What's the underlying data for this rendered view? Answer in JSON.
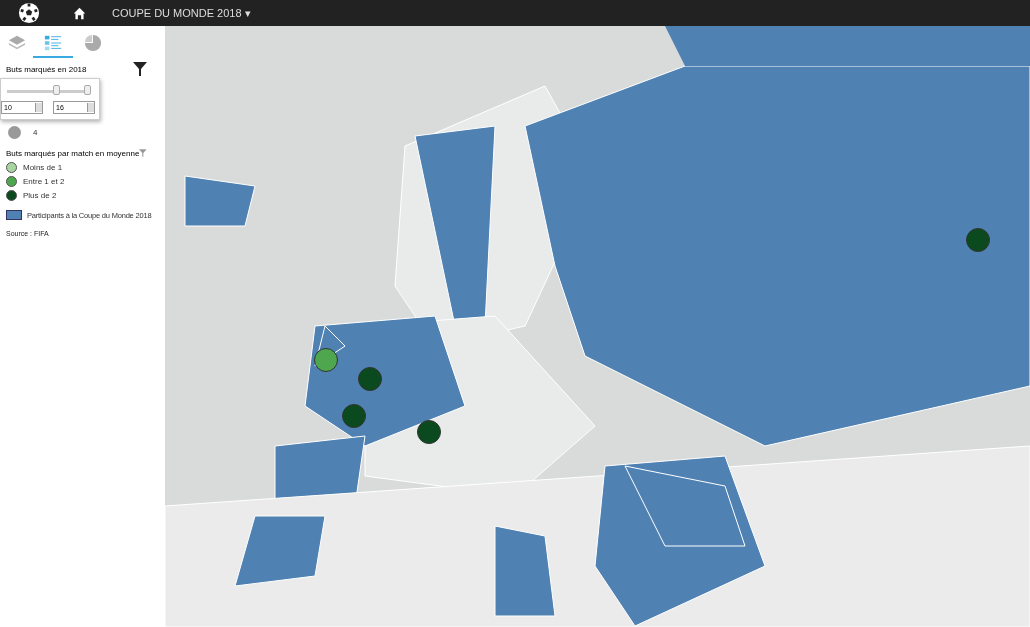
{
  "topbar": {
    "title": "COUPE DU MONDE 2018",
    "caret": "▾"
  },
  "panel_tabs": [
    {
      "kind": "layers",
      "selected": false
    },
    {
      "kind": "legend",
      "selected": true
    },
    {
      "kind": "chart",
      "selected": false
    }
  ],
  "legend": {
    "size_title": "Buts marqués en 2018",
    "size_items": [
      {
        "label": "4"
      }
    ],
    "range": {
      "thumbs": [
        {
          "level": 0.62
        },
        {
          "level": 1
        }
      ],
      "min": "10",
      "max": "16"
    },
    "color_title": "Buts marqués par match en moyenne",
    "color_items": [
      {
        "label": "Moins de 1",
        "color": "#a8d5a0"
      },
      {
        "label": "Entre 1 et 2",
        "color": "#4ea64e"
      },
      {
        "label": "Plus de 2",
        "color": "#0b4a1e"
      }
    ],
    "participants": {
      "label": "Participants à la Coupe du Monde 2018",
      "color": "#4f81b3"
    },
    "source": "Source : FIFA"
  },
  "map": {
    "kind": "picture",
    "markers": [
      {
        "color": "#4ea64e"
      },
      {
        "color": "#0b4a1e"
      },
      {
        "color": "#0b4a1e"
      },
      {
        "color": "#0b4a1e"
      },
      {
        "color": "#0b4a1e"
      }
    ]
  }
}
